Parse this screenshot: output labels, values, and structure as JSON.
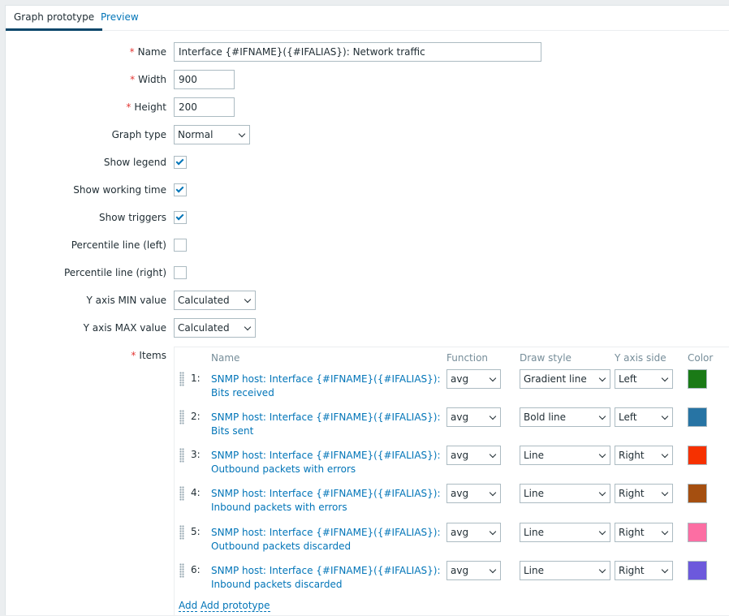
{
  "tabs": {
    "graph_prototype": "Graph prototype",
    "preview": "Preview"
  },
  "form": {
    "name": {
      "label": "Name",
      "value": "Interface {#IFNAME}({#IFALIAS}): Network traffic"
    },
    "width": {
      "label": "Width",
      "value": "900"
    },
    "height": {
      "label": "Height",
      "value": "200"
    },
    "graph_type": {
      "label": "Graph type",
      "value": "Normal"
    },
    "show_legend": {
      "label": "Show legend",
      "checked": true
    },
    "show_working_time": {
      "label": "Show working time",
      "checked": true
    },
    "show_triggers": {
      "label": "Show triggers",
      "checked": true
    },
    "percentile_left": {
      "label": "Percentile line (left)",
      "checked": false
    },
    "percentile_right": {
      "label": "Percentile line (right)",
      "checked": false
    },
    "y_min": {
      "label": "Y axis MIN value",
      "value": "Calculated"
    },
    "y_max": {
      "label": "Y axis MAX value",
      "value": "Calculated"
    },
    "items_label": "Items",
    "required_mark": "*"
  },
  "items_table": {
    "headers": {
      "name": "Name",
      "function": "Function",
      "draw_style": "Draw style",
      "y_axis_side": "Y axis side",
      "color": "Color"
    },
    "rows": [
      {
        "num": "1:",
        "name": "SNMP host: Interface {#IFNAME}({#IFALIAS}): Bits received",
        "function": "avg",
        "draw_style": "Gradient line",
        "y_axis_side": "Left",
        "color": "#1a7a16"
      },
      {
        "num": "2:",
        "name": "SNMP host: Interface {#IFNAME}({#IFALIAS}): Bits sent",
        "function": "avg",
        "draw_style": "Bold line",
        "y_axis_side": "Left",
        "color": "#2774a4"
      },
      {
        "num": "3:",
        "name": "SNMP host: Interface {#IFNAME}({#IFALIAS}): Outbound packets with errors",
        "function": "avg",
        "draw_style": "Line",
        "y_axis_side": "Right",
        "color": "#f63100"
      },
      {
        "num": "4:",
        "name": "SNMP host: Interface {#IFNAME}({#IFALIAS}): Inbound packets with errors",
        "function": "avg",
        "draw_style": "Line",
        "y_axis_side": "Right",
        "color": "#a54f10"
      },
      {
        "num": "5:",
        "name": "SNMP host: Interface {#IFNAME}({#IFALIAS}): Outbound packets discarded",
        "function": "avg",
        "draw_style": "Line",
        "y_axis_side": "Right",
        "color": "#fc6ea3"
      },
      {
        "num": "6:",
        "name": "SNMP host: Interface {#IFNAME}({#IFALIAS}): Inbound packets discarded",
        "function": "avg",
        "draw_style": "Line",
        "y_axis_side": "Right",
        "color": "#6c59dc"
      }
    ],
    "add_label": "Add",
    "add_prototype_label": "Add prototype"
  }
}
